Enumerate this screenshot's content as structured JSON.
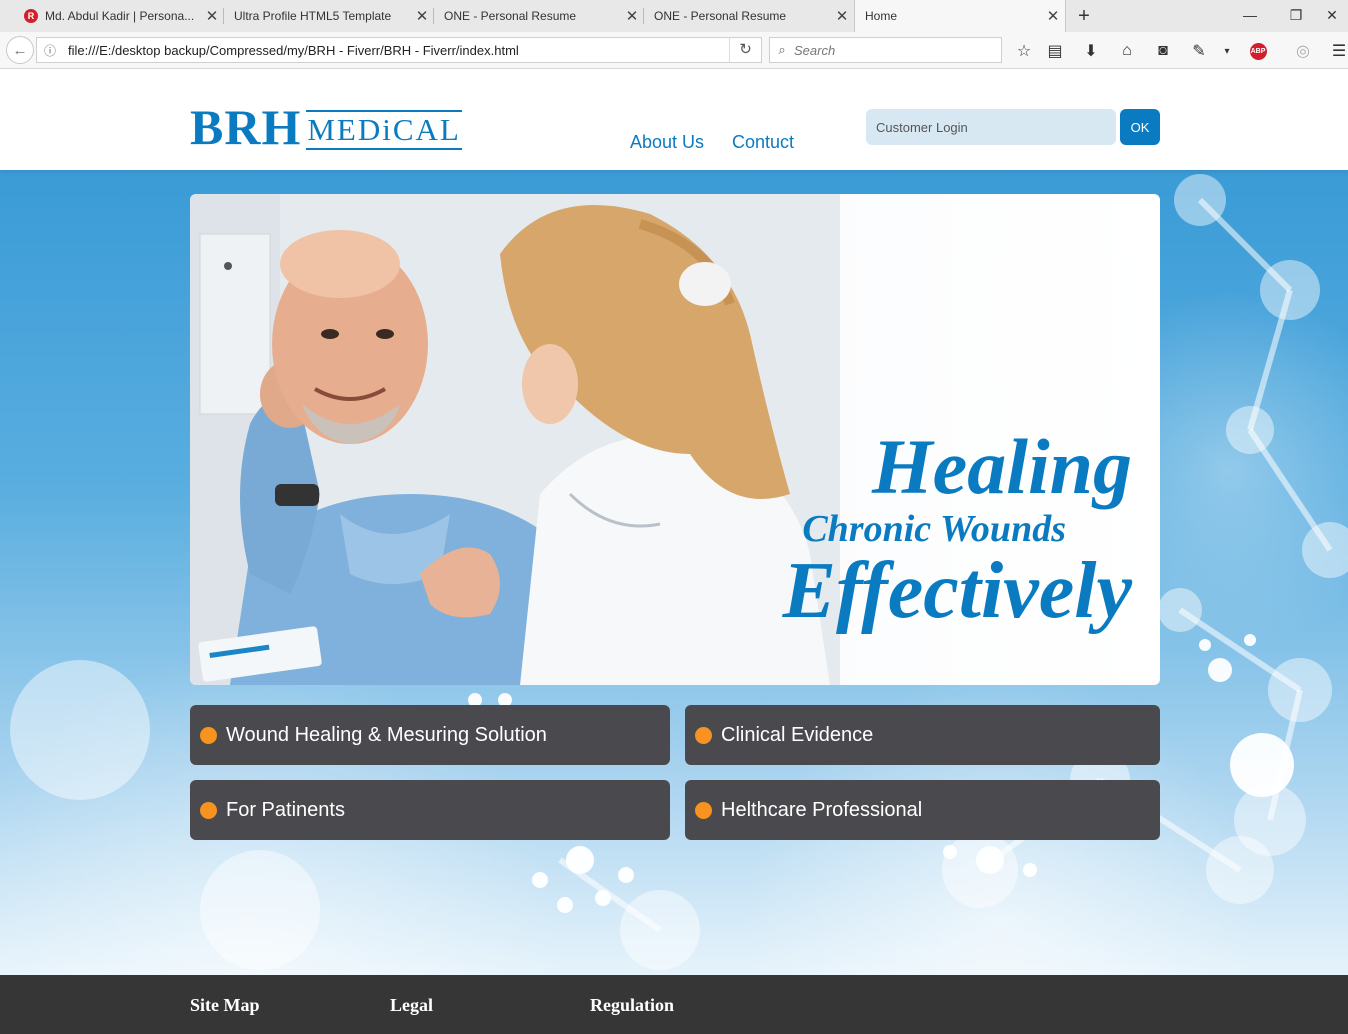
{
  "browser": {
    "tabs": [
      {
        "title": "Md. Abdul Kadir | Persona...",
        "favicon": "R"
      },
      {
        "title": "Ultra Profile HTML5 Template"
      },
      {
        "title": "ONE - Personal Resume"
      },
      {
        "title": "ONE - Personal Resume"
      },
      {
        "title": "Home",
        "active": true
      }
    ],
    "url": "file:///E:/desktop backup/Compressed/my/BRH - Fiverr/BRH - Fiverr/index.html",
    "search_placeholder": "Search",
    "adblock_label": "ABP",
    "toolbar_icons": [
      "bookmark-star-icon",
      "reading-list-icon",
      "download-icon",
      "home-icon",
      "pocket-icon",
      "extension-icon",
      "adblock-icon",
      "sync-icon",
      "menu-icon"
    ]
  },
  "site": {
    "logo": {
      "brh": "BRH",
      "medical": "MEDiCAL"
    },
    "nav": {
      "about": "About Us",
      "contact": "Contuct"
    },
    "login": {
      "placeholder": "Customer Login",
      "ok_label": "OK"
    },
    "hero": {
      "line1": "Healing",
      "line2": "Chronic Wounds",
      "line3": "Effectively"
    },
    "features": [
      {
        "label": "Wound Healing & Mesuring Solution"
      },
      {
        "label": "Clinical Evidence"
      },
      {
        "label": "For Patinents"
      },
      {
        "label": "Helthcare Professional"
      }
    ],
    "footer": {
      "sitemap": "Site Map",
      "legal": "Legal",
      "regulation": "Regulation"
    },
    "colors": {
      "brand_blue": "#0a7bc1",
      "feature_bg": "#4a4a4e",
      "bullet_orange": "#f7931e",
      "footer_bg": "#363636"
    }
  }
}
